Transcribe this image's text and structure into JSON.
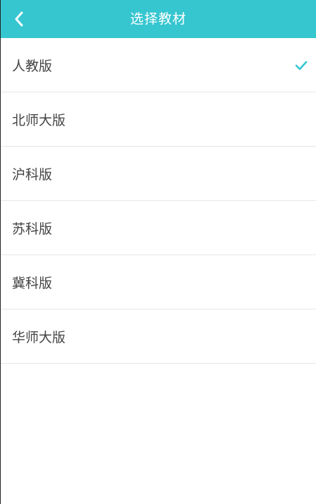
{
  "header": {
    "title": "选择教材"
  },
  "colors": {
    "accent": "#35c6d0",
    "text": "#444444",
    "divider": "#e6e6e6"
  },
  "textbooks": {
    "selected_index": 0,
    "items": [
      {
        "label": "人教版",
        "selected": true
      },
      {
        "label": "北师大版",
        "selected": false
      },
      {
        "label": "沪科版",
        "selected": false
      },
      {
        "label": "苏科版",
        "selected": false
      },
      {
        "label": "冀科版",
        "selected": false
      },
      {
        "label": "华师大版",
        "selected": false
      }
    ]
  },
  "icons": {
    "back": "chevron-left-icon",
    "selected": "checkmark-icon"
  }
}
